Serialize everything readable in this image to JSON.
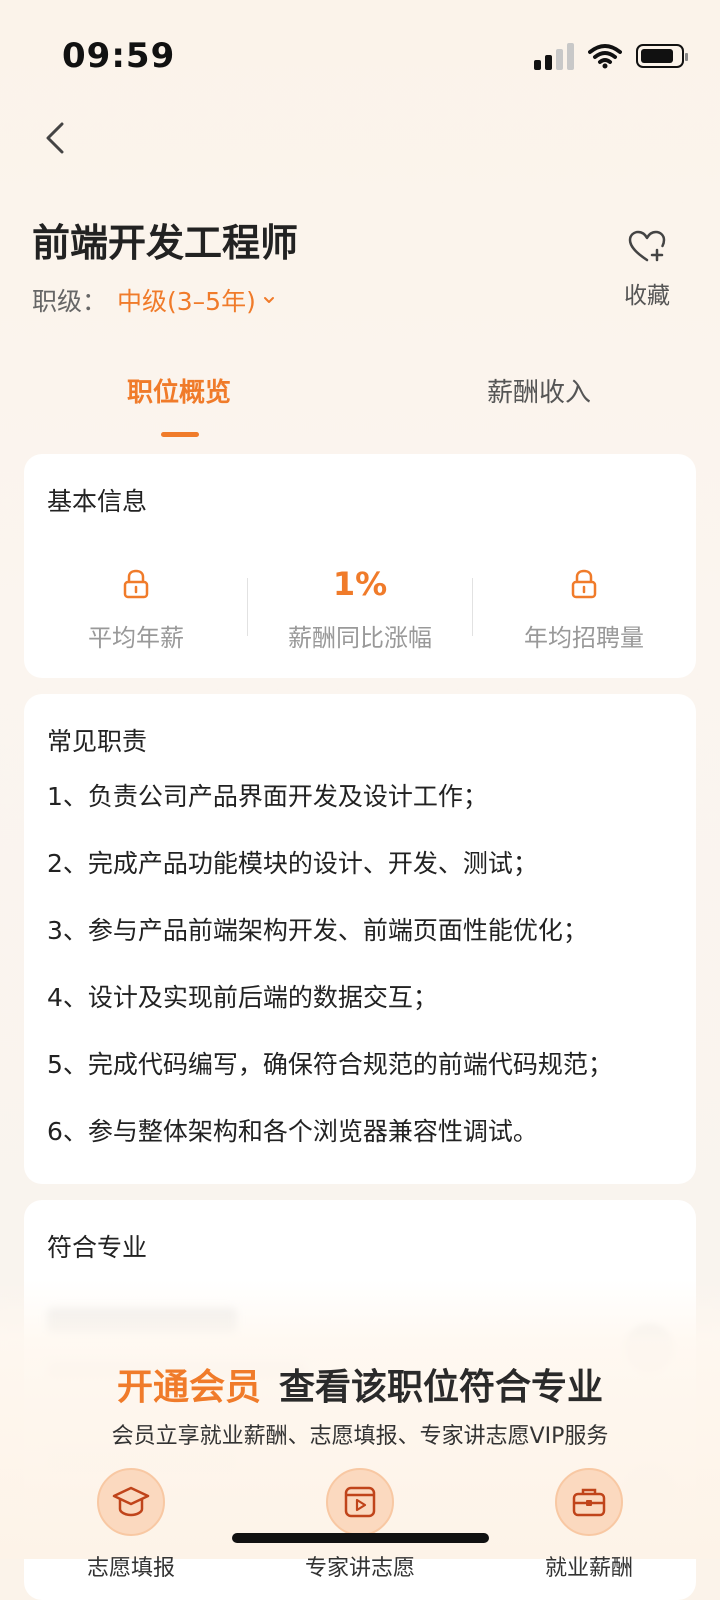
{
  "status": {
    "time": "09:59"
  },
  "header": {
    "title": "前端开发工程师",
    "level_label": "职级：",
    "level_value": "中级(3–5年)",
    "favorite_label": "收藏"
  },
  "tabs": [
    {
      "label": "职位概览",
      "active": true
    },
    {
      "label": "薪酬收入",
      "active": false
    }
  ],
  "basic_info": {
    "title": "基本信息",
    "stats": [
      {
        "label": "平均年薪",
        "value": "",
        "locked": true
      },
      {
        "label": "薪酬同比涨幅",
        "value": "1%",
        "locked": false
      },
      {
        "label": "年均招聘量",
        "value": "",
        "locked": true
      }
    ]
  },
  "duties": {
    "title": "常见职责",
    "items": [
      "1、负责公司产品界面开发及设计工作；",
      "2、完成产品功能模块的设计、开发、测试；",
      "3、参与产品前端架构开发、前端页面性能优化；",
      "4、设计及实现前后端的数据交互；",
      "5、完成代码编写，确保符合规范的前端代码规范；",
      "6、参与整体架构和各个浏览器兼容性调试。"
    ]
  },
  "majors": {
    "title": "符合专业"
  },
  "promo": {
    "highlight": "开通会员",
    "title": "查看该职位符合专业",
    "subtitle": "会员立享就业薪酬、志愿填报、专家讲志愿VIP服务",
    "features": [
      {
        "label": "志愿填报",
        "icon": "graduation-cap-icon"
      },
      {
        "label": "专家讲志愿",
        "icon": "video-play-icon"
      },
      {
        "label": "就业薪酬",
        "icon": "briefcase-icon"
      }
    ]
  },
  "colors": {
    "accent": "#f07b2a",
    "background": "#fbf3ea",
    "card": "#ffffff"
  }
}
